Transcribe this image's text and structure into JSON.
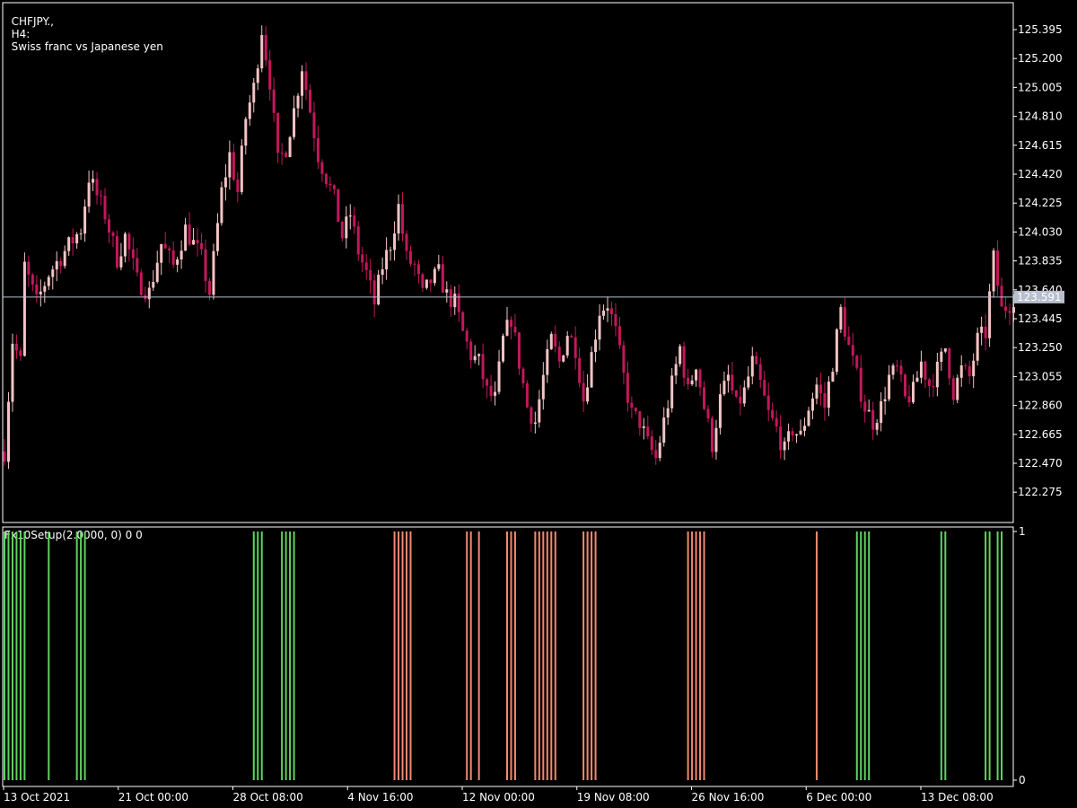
{
  "header": {
    "symbol": "CHFJPY.,",
    "timeframe": "H4:",
    "description": "Swiss franc vs Japanese yen"
  },
  "indicator": {
    "label": "Fx10Setup(2.0000, 0) 0 0"
  },
  "colors": {
    "background": "#000000",
    "axis": "#ffffff",
    "bull_candle": "#f2c4c4",
    "bear_candle": "#c2185b",
    "bid_line": "#b7bfcf",
    "buy_signal": "#5fd35f",
    "sell_signal": "#f08a6e",
    "price_tag_bg": "#b7bfcf"
  },
  "chart_data": [
    {
      "type": "candlestick",
      "symbol": "CHFJPY.",
      "timeframe": "H4",
      "ylim": [
        122.2,
        125.45
      ],
      "price_ticks": [
        "125.395",
        "125.200",
        "125.005",
        "124.810",
        "124.615",
        "124.420",
        "124.225",
        "124.030",
        "123.835",
        "123.640",
        "123.445",
        "123.250",
        "123.055",
        "122.860",
        "122.665",
        "122.470",
        "122.275"
      ],
      "current_price": "123.591",
      "time_ticks": [
        "13 Oct 2021",
        "21 Oct 00:00",
        "28 Oct 08:00",
        "4 Nov 16:00",
        "12 Nov 00:00",
        "19 Nov 08:00",
        "26 Nov 16:00",
        "6 Dec 00:00",
        "13 Dec 08:00"
      ],
      "close_path": [
        [
          0,
          122.55
        ],
        [
          2,
          123.3
        ],
        [
          4,
          123.15
        ],
        [
          5,
          123.8
        ],
        [
          8,
          123.55
        ],
        [
          11,
          123.75
        ],
        [
          15,
          123.9
        ],
        [
          19,
          124.05
        ],
        [
          21,
          124.4
        ],
        [
          25,
          124.15
        ],
        [
          28,
          123.85
        ],
        [
          30,
          124.0
        ],
        [
          33,
          123.7
        ],
        [
          36,
          123.62
        ],
        [
          39,
          123.95
        ],
        [
          42,
          123.8
        ],
        [
          45,
          124.05
        ],
        [
          49,
          123.85
        ],
        [
          51,
          123.62
        ],
        [
          54,
          124.3
        ],
        [
          56,
          124.55
        ],
        [
          58,
          124.3
        ],
        [
          60,
          124.8
        ],
        [
          62,
          125.0
        ],
        [
          64,
          125.4
        ],
        [
          66,
          125.05
        ],
        [
          68,
          124.5
        ],
        [
          70,
          124.6
        ],
        [
          72,
          124.85
        ],
        [
          74,
          125.15
        ],
        [
          76,
          124.85
        ],
        [
          78,
          124.55
        ],
        [
          80,
          124.4
        ],
        [
          82,
          124.25
        ],
        [
          84,
          124.0
        ],
        [
          86,
          124.15
        ],
        [
          88,
          123.9
        ],
        [
          90,
          123.75
        ],
        [
          92,
          123.55
        ],
        [
          94,
          123.8
        ],
        [
          96,
          123.95
        ],
        [
          98,
          124.2
        ],
        [
          100,
          123.85
        ],
        [
          102,
          123.8
        ],
        [
          104,
          123.6
        ],
        [
          106,
          123.7
        ],
        [
          108,
          123.75
        ],
        [
          110,
          123.6
        ],
        [
          112,
          123.55
        ],
        [
          114,
          123.35
        ],
        [
          116,
          123.2
        ],
        [
          118,
          123.15
        ],
        [
          120,
          122.95
        ],
        [
          122,
          122.9
        ],
        [
          124,
          123.3
        ],
        [
          126,
          123.45
        ],
        [
          128,
          123.15
        ],
        [
          130,
          122.85
        ],
        [
          132,
          122.75
        ],
        [
          134,
          123.05
        ],
        [
          136,
          123.3
        ],
        [
          138,
          123.15
        ],
        [
          140,
          123.35
        ],
        [
          142,
          123.25
        ],
        [
          144,
          122.9
        ],
        [
          146,
          123.2
        ],
        [
          148,
          123.5
        ],
        [
          150,
          123.55
        ],
        [
          152,
          123.35
        ],
        [
          154,
          123.05
        ],
        [
          156,
          122.8
        ],
        [
          158,
          122.75
        ],
        [
          160,
          122.6
        ],
        [
          162,
          122.5
        ],
        [
          164,
          122.75
        ],
        [
          166,
          123.0
        ],
        [
          168,
          123.25
        ],
        [
          170,
          122.95
        ],
        [
          172,
          123.15
        ],
        [
          174,
          122.85
        ],
        [
          176,
          122.6
        ],
        [
          178,
          122.9
        ],
        [
          180,
          123.05
        ],
        [
          182,
          122.85
        ],
        [
          184,
          122.95
        ],
        [
          186,
          123.15
        ],
        [
          188,
          123.0
        ],
        [
          190,
          122.8
        ],
        [
          192,
          122.7
        ],
        [
          194,
          122.55
        ],
        [
          196,
          122.7
        ],
        [
          198,
          122.65
        ],
        [
          200,
          122.85
        ],
        [
          202,
          123.0
        ],
        [
          204,
          122.85
        ],
        [
          206,
          123.15
        ],
        [
          208,
          123.5
        ],
        [
          210,
          123.25
        ],
        [
          212,
          123.05
        ],
        [
          214,
          122.85
        ],
        [
          216,
          122.75
        ],
        [
          218,
          122.85
        ],
        [
          220,
          123.05
        ],
        [
          222,
          123.1
        ],
        [
          224,
          122.9
        ],
        [
          226,
          122.95
        ],
        [
          228,
          123.15
        ],
        [
          230,
          123.0
        ],
        [
          232,
          123.1
        ],
        [
          234,
          123.25
        ],
        [
          236,
          122.95
        ],
        [
          238,
          123.1
        ],
        [
          240,
          123.05
        ],
        [
          242,
          123.3
        ],
        [
          244,
          123.35
        ],
        [
          246,
          123.85
        ],
        [
          248,
          123.5
        ],
        [
          250,
          123.55
        ],
        [
          251,
          123.591
        ]
      ]
    },
    {
      "type": "bar",
      "name": "Fx10Setup",
      "ylim": [
        0,
        1
      ],
      "y_ticks": [
        "1",
        "0"
      ],
      "buy_bars": [
        0,
        1,
        2,
        3,
        4,
        5,
        11,
        18,
        19,
        20,
        62,
        63,
        64,
        69,
        70,
        71,
        72,
        212,
        213,
        214,
        215,
        233,
        234,
        244,
        245,
        247,
        248
      ],
      "sell_bars": [
        97,
        98,
        99,
        100,
        101,
        115,
        116,
        118,
        125,
        126,
        127,
        132,
        133,
        134,
        135,
        136,
        137,
        144,
        145,
        146,
        147,
        170,
        171,
        172,
        173,
        174,
        202
      ]
    }
  ]
}
